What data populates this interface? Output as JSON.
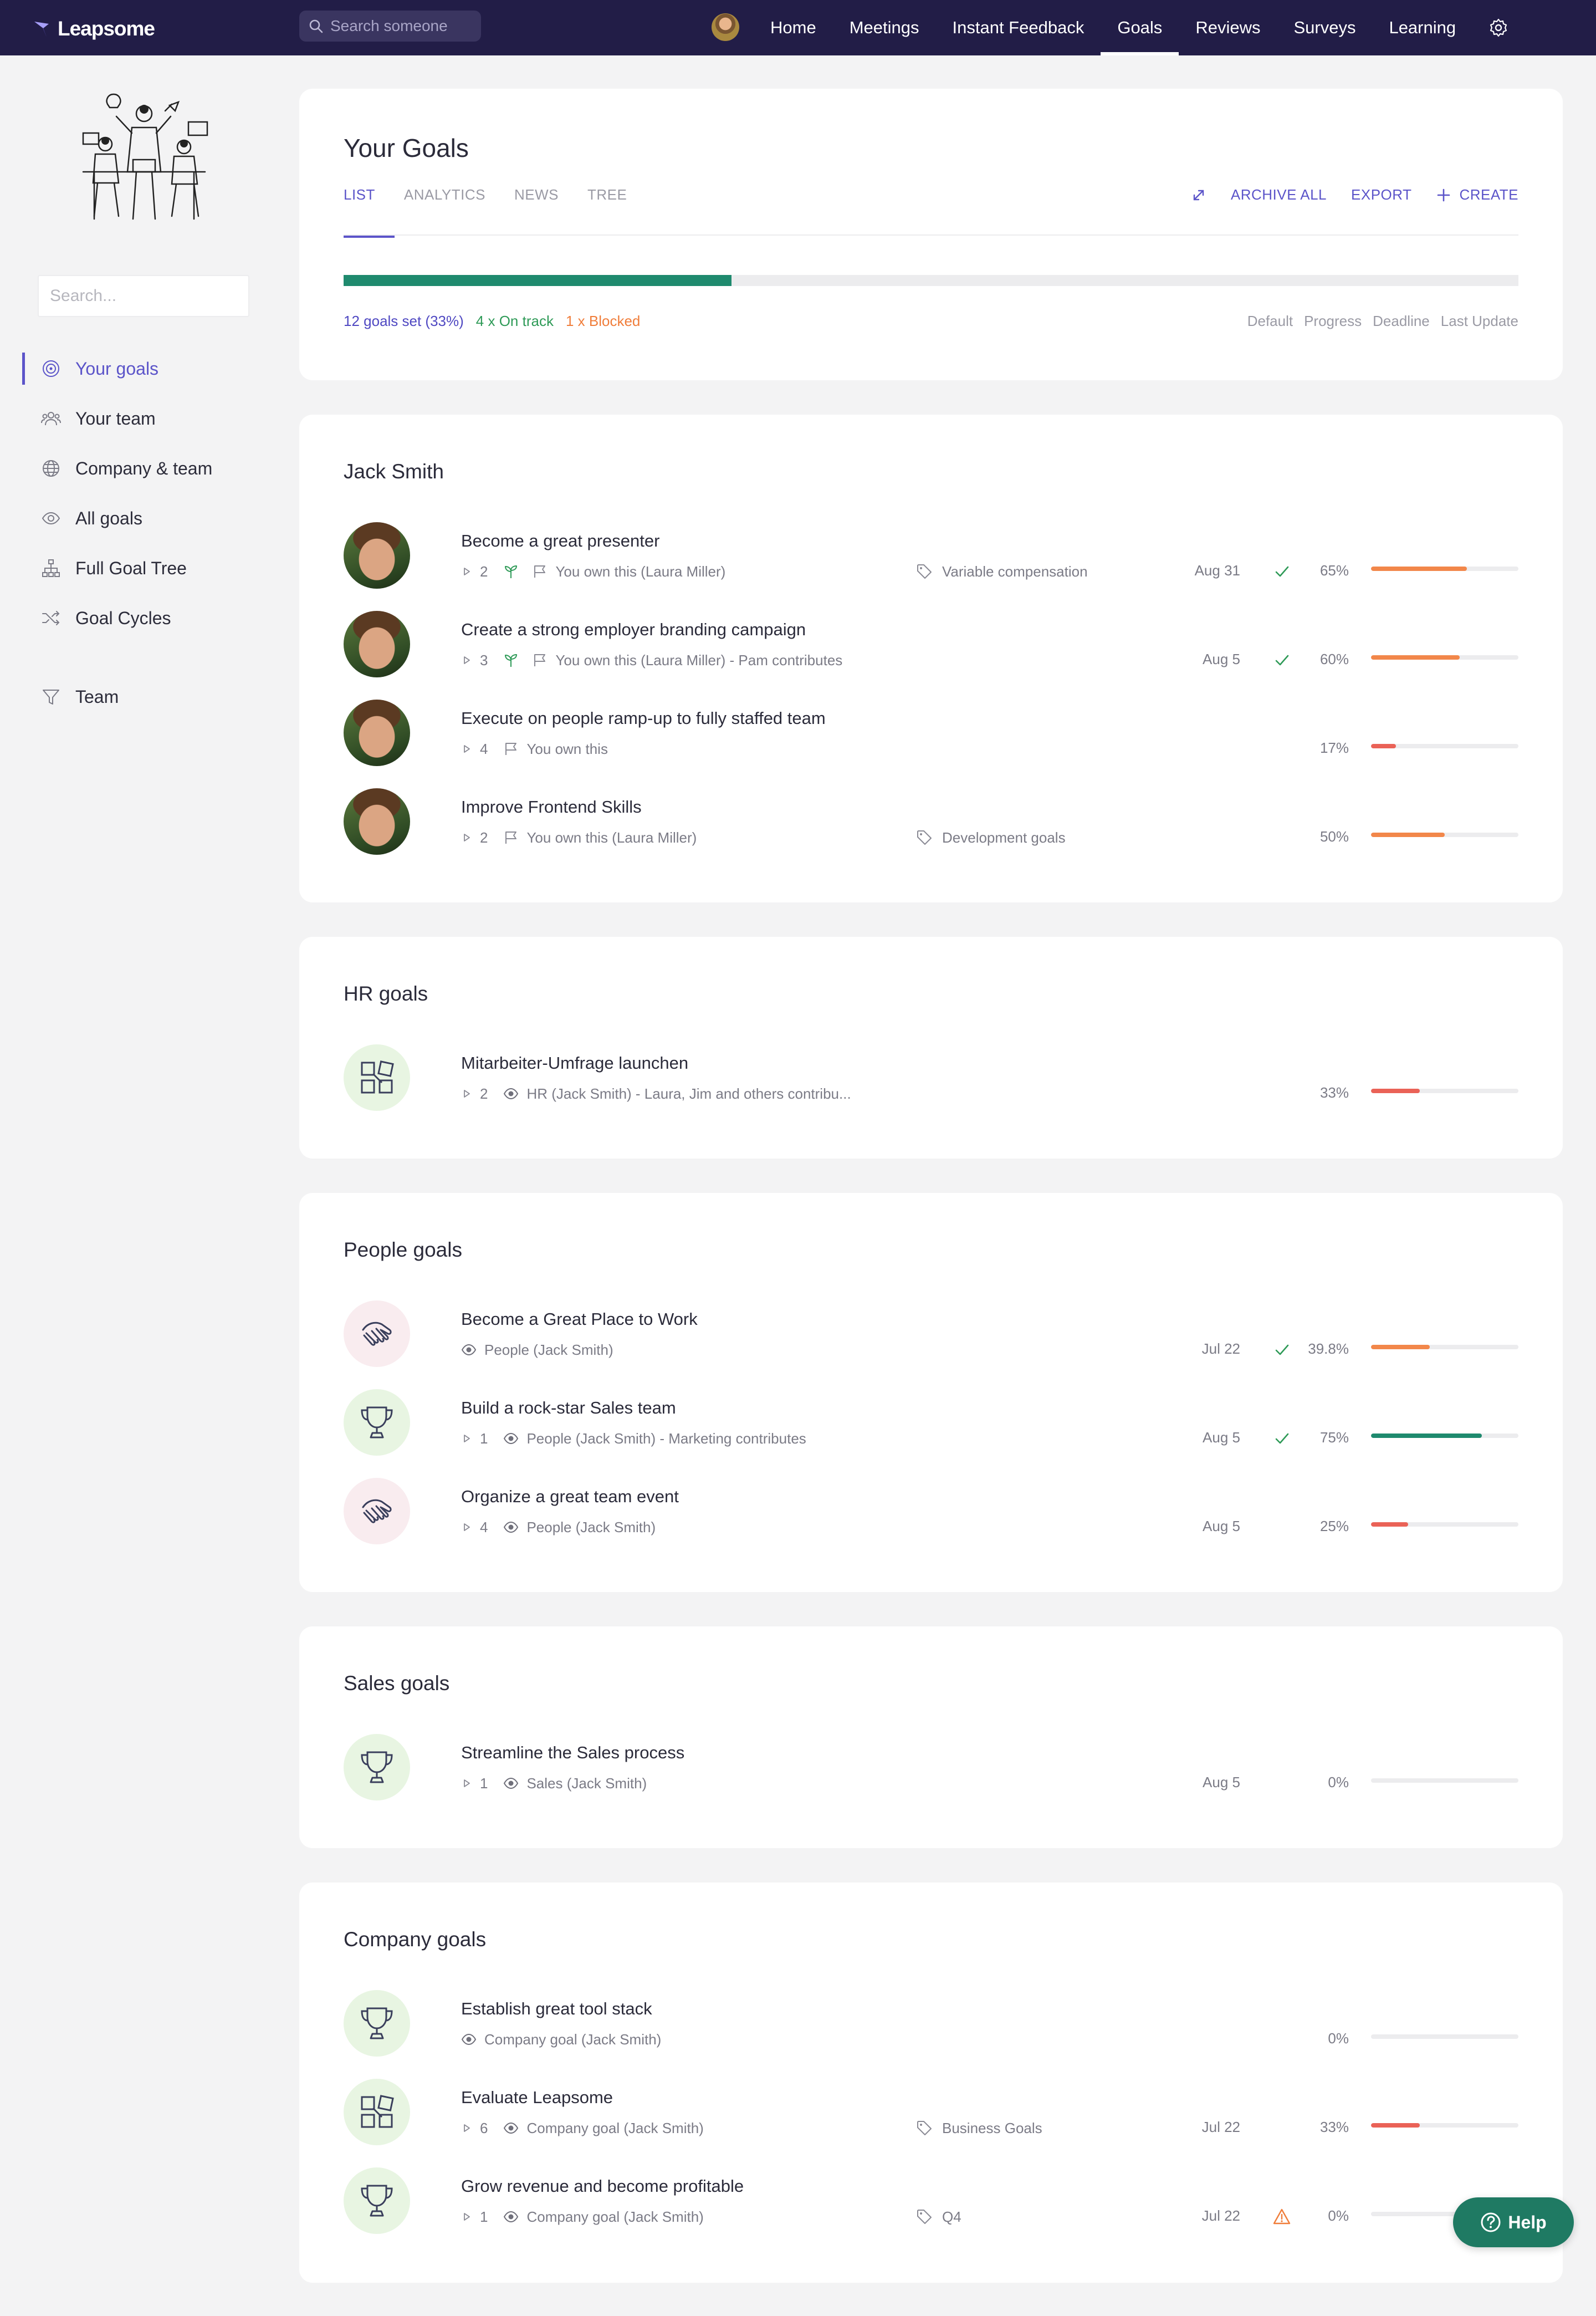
{
  "app": {
    "name": "Leapsome"
  },
  "search": {
    "placeholder": "Search someone"
  },
  "nav": {
    "items": [
      {
        "label": "Home"
      },
      {
        "label": "Meetings"
      },
      {
        "label": "Instant Feedback"
      },
      {
        "label": "Goals",
        "active": true
      },
      {
        "label": "Reviews"
      },
      {
        "label": "Surveys"
      },
      {
        "label": "Learning"
      }
    ]
  },
  "sidebar": {
    "search_placeholder": "Search...",
    "items": [
      {
        "label": "Your goals",
        "icon": "target-icon",
        "active": true
      },
      {
        "label": "Your team",
        "icon": "team-icon"
      },
      {
        "label": "Company & team",
        "icon": "globe-icon"
      },
      {
        "label": "All goals",
        "icon": "eye-icon"
      },
      {
        "label": "Full Goal Tree",
        "icon": "tree-icon"
      },
      {
        "label": "Goal Cycles",
        "icon": "shuffle-icon"
      },
      {
        "label": "Team",
        "icon": "filter-icon"
      }
    ]
  },
  "header": {
    "title": "Your Goals",
    "tabs": [
      "LIST",
      "ANALYTICS",
      "NEWS",
      "TREE"
    ],
    "actions": {
      "archive": "ARCHIVE ALL",
      "export": "EXPORT",
      "create": "CREATE"
    },
    "progress": 0.33,
    "stats": {
      "set": "12 goals set (33%)",
      "on_track": "4 x On track",
      "blocked": "1 x Blocked"
    },
    "sorts": [
      "Default",
      "Progress",
      "Deadline",
      "Last Update"
    ]
  },
  "colors": {
    "accent": "#5b54c9",
    "nav_bg": "#221d47",
    "green": "#1f8a6e",
    "orange": "#f2874a",
    "red": "#ea6257"
  },
  "sections": [
    {
      "title": "Jack Smith",
      "goals": [
        {
          "title": "Become a great presenter",
          "count": "2",
          "owner": "You own this (Laura Miller)",
          "tag": "Variable compensation",
          "date": "Aug 31",
          "status": "check",
          "pct": "65%",
          "progress": 0.65,
          "bar": "orange"
        },
        {
          "title": "Create a strong employer branding campaign",
          "count": "3",
          "owner": "You own this (Laura Miller) - Pam contributes",
          "tag": "",
          "date": "Aug 5",
          "status": "check",
          "pct": "60%",
          "progress": 0.6,
          "bar": "orange"
        },
        {
          "title": "Execute on people ramp-up to fully staffed team",
          "count": "4",
          "owner": "You own this",
          "tag": "",
          "date": "",
          "status": "",
          "pct": "17%",
          "progress": 0.17,
          "bar": "red"
        },
        {
          "title": "Improve Frontend Skills",
          "count": "2",
          "owner": "You own this (Laura Miller)",
          "tag": "Development goals",
          "date": "",
          "status": "",
          "pct": "50%",
          "progress": 0.5,
          "bar": "orange"
        }
      ]
    },
    {
      "title": "HR goals",
      "goals": [
        {
          "title": "Mitarbeiter-Umfrage launchen",
          "count": "2",
          "owner": "HR (Jack Smith) - Laura, Jim and others contribu...",
          "tag": "",
          "date": "",
          "status": "",
          "pct": "33%",
          "progress": 0.33,
          "bar": "red"
        }
      ]
    },
    {
      "title": "People goals",
      "goals": [
        {
          "title": "Become a Great Place to Work",
          "count": "",
          "owner": "People (Jack Smith)",
          "tag": "",
          "date": "Jul 22",
          "status": "check",
          "pct": "39.8%",
          "progress": 0.398,
          "bar": "orange"
        },
        {
          "title": "Build a rock-star Sales team",
          "count": "1",
          "owner": "People (Jack Smith) - Marketing contributes",
          "tag": "",
          "date": "Aug 5",
          "status": "check",
          "pct": "75%",
          "progress": 0.75,
          "bar": "green"
        },
        {
          "title": "Organize a great team event",
          "count": "4",
          "owner": "People (Jack Smith)",
          "tag": "",
          "date": "Aug 5",
          "status": "",
          "pct": "25%",
          "progress": 0.25,
          "bar": "red"
        }
      ]
    },
    {
      "title": "Sales goals",
      "goals": [
        {
          "title": "Streamline the Sales process",
          "count": "1",
          "owner": "Sales (Jack Smith)",
          "tag": "",
          "date": "Aug 5",
          "status": "",
          "pct": "0%",
          "progress": 0,
          "bar": "red"
        }
      ]
    },
    {
      "title": "Company goals",
      "goals": [
        {
          "title": "Establish great tool stack",
          "count": "",
          "owner": "Company goal (Jack Smith)",
          "tag": "",
          "date": "",
          "status": "",
          "pct": "0%",
          "progress": 0,
          "bar": "red"
        },
        {
          "title": "Evaluate Leapsome",
          "count": "6",
          "owner": "Company goal (Jack Smith)",
          "tag": "Business Goals",
          "date": "Jul 22",
          "status": "",
          "pct": "33%",
          "progress": 0.33,
          "bar": "red"
        },
        {
          "title": "Grow revenue and become profitable",
          "count": "1",
          "owner": "Company goal (Jack Smith)",
          "tag": "Q4",
          "date": "Jul 22",
          "status": "warning",
          "pct": "0%",
          "progress": 0,
          "bar": "red"
        }
      ]
    }
  ],
  "help": {
    "label": "Help"
  }
}
